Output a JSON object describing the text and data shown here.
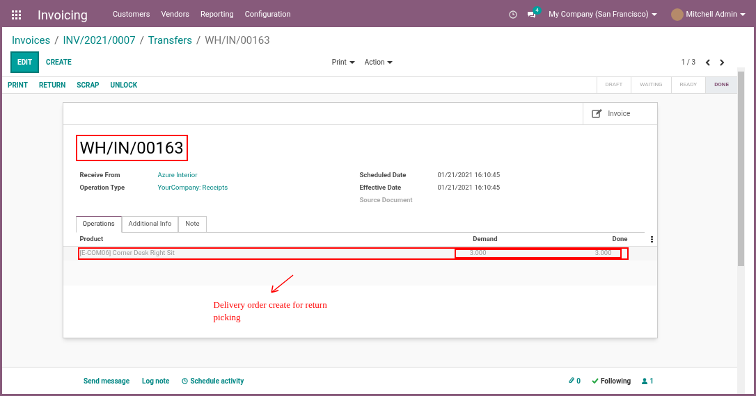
{
  "navbar": {
    "app_name": "Invoicing",
    "menu": [
      "Customers",
      "Vendors",
      "Reporting",
      "Configuration"
    ],
    "messages_badge": "4",
    "company": "My Company (San Francisco)",
    "user": "Mitchell Admin"
  },
  "breadcrumbs": [
    {
      "label": "Invoices",
      "current": false
    },
    {
      "separator": "/",
      "label": "INV/2021/0007",
      "current": false
    },
    {
      "separator": "/",
      "label": "Transfers",
      "current": false
    },
    {
      "separator": "/",
      "label": "WH/IN/00163",
      "current": true
    }
  ],
  "control_panel": {
    "primary_button": "EDIT",
    "secondary_button": "CREATE",
    "menus": [
      "Print",
      "Action"
    ],
    "pager": "1 / 3"
  },
  "header_buttons": [
    "PRINT",
    "RETURN",
    "SCRAP",
    "UNLOCK"
  ],
  "status_steps": [
    {
      "label": "DRAFT",
      "selected": false
    },
    {
      "label": "WAITING",
      "selected": false
    },
    {
      "label": "READY",
      "selected": false
    },
    {
      "label": "DONE",
      "selected": true
    }
  ],
  "smart_button": "Invoice",
  "title": "WH/IN/00163",
  "fields_left": [
    {
      "label": "Receive From",
      "value": "Azure Interior",
      "kind": "link"
    },
    {
      "label": "Operation Type",
      "value": "YourCompany: Receipts",
      "kind": "link"
    }
  ],
  "fields_right": [
    {
      "label": "Scheduled Date",
      "value": "01/21/2021 16:10:45",
      "kind": "text"
    },
    {
      "label": "Effective Date",
      "value": "01/21/2021 16:10:45",
      "kind": "text"
    },
    {
      "label": "Source Document",
      "kind": "empty"
    }
  ],
  "tabs": [
    {
      "label": "Operations",
      "selected": true
    },
    {
      "label": "Additional Info",
      "selected": false
    },
    {
      "label": "Note",
      "selected": false
    }
  ],
  "table": {
    "columns": [
      "Product",
      "Demand",
      "Done"
    ],
    "rows": [
      {
        "product": "[E-COM06] Corner Desk Right Sit",
        "demand": "3.000",
        "done": "3.000"
      }
    ]
  },
  "annotation": "Delivery order create for return picking",
  "chatter": {
    "send_message": "Send message",
    "log_note": "Log note",
    "schedule_activity": "Schedule activity",
    "attachments": "0",
    "following": "Following",
    "followers": "1"
  }
}
